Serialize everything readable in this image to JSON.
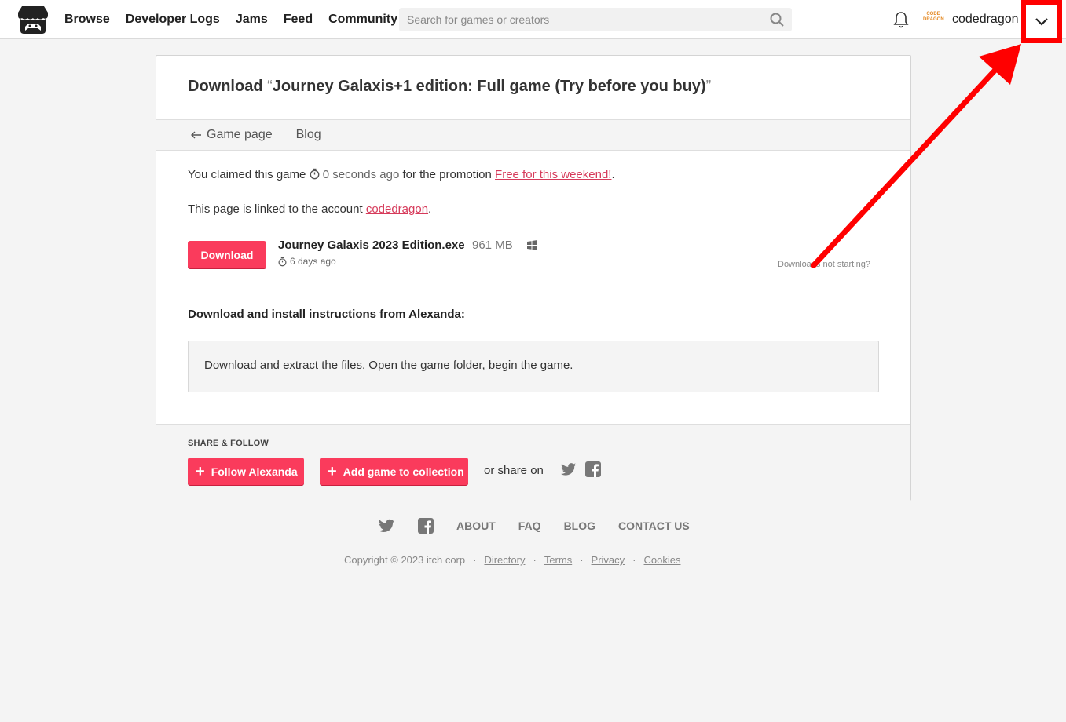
{
  "header": {
    "nav": [
      "Browse",
      "Developer Logs",
      "Jams",
      "Feed",
      "Community"
    ],
    "search_placeholder": "Search for games or creators",
    "avatar_text": "CODE DRAGON",
    "username": "codedragon"
  },
  "card": {
    "title_prefix": "Download",
    "open_quote": "“",
    "title_game": "Journey Galaxis+1 edition: Full game (Try before you buy)",
    "close_quote": "”",
    "subnav": {
      "game_page": "Game page",
      "blog": "Blog"
    },
    "claim": {
      "prefix": "You claimed this game",
      "time": "0 seconds ago",
      "middle": "for the promotion",
      "promo_link": "Free for this weekend!",
      "suffix": "."
    },
    "linked": {
      "prefix": "This page is linked to the account",
      "account": "codedragon",
      "suffix": "."
    },
    "download_button": "Download",
    "file": {
      "name": "Journey Galaxis 2023 Edition.exe",
      "size": "961 MB",
      "date": "6 days ago",
      "platform_icon": "windows-icon"
    },
    "not_starting": "Downloads not starting?",
    "instructions_title": "Download and install instructions from Alexanda:",
    "instructions_text": "Download and extract the files. Open the game folder, begin the game.",
    "share": {
      "label": "SHARE & FOLLOW",
      "follow_button": "Follow Alexanda",
      "collection_button": "Add game to collection",
      "share_on": "or share on"
    }
  },
  "footer": {
    "links": [
      "ABOUT",
      "FAQ",
      "BLOG",
      "CONTACT US"
    ],
    "copyright": "Copyright © 2023 itch corp",
    "sep": "·",
    "legal": [
      "Directory",
      "Terms",
      "Privacy",
      "Cookies"
    ]
  },
  "colors": {
    "accent": "#fa3b5c",
    "link": "#d63a5a",
    "annotation": "#ff0000"
  }
}
